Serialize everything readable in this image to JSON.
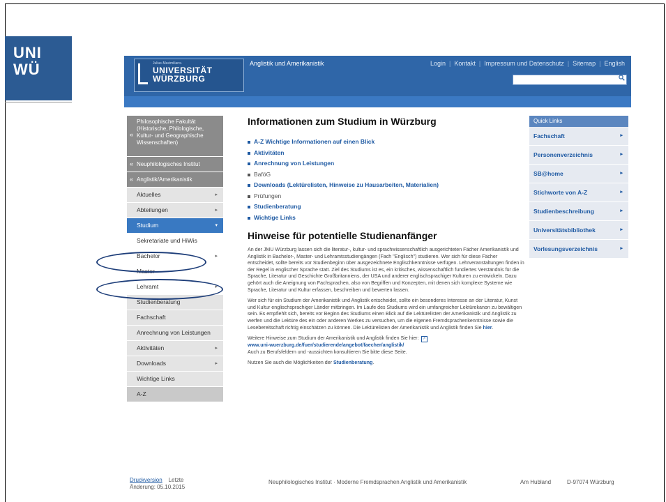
{
  "slide": {
    "logo_line1": "UNI",
    "logo_line2": "WÜ"
  },
  "header": {
    "logo_small": "Julius-Maximilians-",
    "logo_line1": "UNIVERSITÄT",
    "logo_line2": "WÜRZBURG",
    "institute": "Anglistik und Amerikanistik",
    "nav": [
      "Login",
      "Kontakt",
      "Impressum und Datenschutz",
      "Sitemap",
      "English"
    ],
    "search_placeholder": "",
    "search_icon": "search-icon"
  },
  "leftnav": {
    "faculty": "Philosophische Fakultät (Historische, Philologische, Kultur- und Geographische Wissenschaften)",
    "institute": "Neuphilologisches Institut",
    "department": "Anglistik/Amerikanistik",
    "items": [
      {
        "label": "Aktuelles",
        "arrow": "▸"
      },
      {
        "label": "Abteilungen",
        "arrow": "▸"
      },
      {
        "label": "Studium",
        "arrow": "▾"
      },
      {
        "label": "Sekretariate und HiWis",
        "arrow": ""
      },
      {
        "label": "Bachelor",
        "arrow": "▸"
      },
      {
        "label": "Master",
        "arrow": ""
      },
      {
        "label": "Lehramt",
        "arrow": "▸"
      },
      {
        "label": "Studienberatung",
        "arrow": ""
      },
      {
        "label": "Fachschaft",
        "arrow": ""
      },
      {
        "label": "Anrechnung von Leistungen",
        "arrow": ""
      },
      {
        "label": "Aktivitäten",
        "arrow": "▸"
      },
      {
        "label": "Downloads",
        "arrow": "▸"
      },
      {
        "label": "Wichtige Links",
        "arrow": ""
      },
      {
        "label": "A-Z",
        "arrow": ""
      }
    ]
  },
  "main": {
    "title": "Informationen zum Studium in Würzburg",
    "links": [
      "A-Z Wichtige Informationen auf einen Blick",
      "Aktivitäten",
      "Anrechnung von Leistungen",
      "BaföG",
      "Downloads (Lektürelisten, Hinweise zu Hausarbeiten, Materialien)",
      "Prüfungen",
      "Studienberatung",
      "Wichtige Links"
    ],
    "subtitle": "Hinweise für potentielle Studienanfänger",
    "para1": "An der JMU Würzburg lassen sich die literatur-, kultur- und sprachwissenschaftlich ausgerichteten Fächer Amerikanistik und Anglistik in Bachelor-, Master- und Lehramtsstudiengängen (Fach \"Englisch\") studieren. Wer sich für diese Fächer entscheidet, sollte bereits vor Studienbeginn über ausgezeichnete Englischkenntnisse verfügen. Lehrveranstaltungen finden in der Regel in englischer Sprache statt. Ziel des Studiums ist es, ein kritisches, wissenschaftlich fundiertes Verständnis für die Sprache, Literatur und Geschichte Großbritanniens, der USA und anderer englischsprachiger Kulturen zu entwickeln. Dazu gehört auch die Aneignung von Fachsprachen, also von Begriffen und Konzepten, mit denen sich komplexe Systeme wie Sprache, Literatur und Kultur erfassen, beschreiben und bewerten lassen.",
    "para2": "Wer sich für ein Studium der Amerikanistik und Anglistik entscheidet, sollte ein besonderes Interesse an der Literatur, Kunst und Kultur englischsprachiger Länder mitbringen. Im Laufe des Studiums wird ein umfangreicher Lektürekanon zu bewältigen sein. Es empfiehlt sich, bereits vor Beginn des Studiums einen Blick auf die Lektürelisten der Amerikanistik und Anglistik zu werfen und die Lektüre des ein oder anderen Werkes zu versuchen, um die eigenen Fremdsprachenkenntnisse sowie die Lesebereitschaft richtig einschätzen zu können. Die Lektürelisten der Amerikanistik und Anglistik finden Sie ",
    "para2_link": "hier",
    "para3_a": "Weitere Hinweise zum Studium der Amerikanistik und Anglistik finden Sie hier:",
    "para3_link": "www.uni-wuerzburg.de/fuer/studierende/angebot/faecher/anglistik/",
    "para3_b": "Auch zu Berufsfeldern und -aussichten konsultieren Sie bitte diese Seite.",
    "para4_a": "Nutzen Sie auch die Möglichkeiten der ",
    "para4_link": "Studienberatung",
    "para4_b": "."
  },
  "quick": {
    "heading": "Quick Links",
    "items": [
      "Fachschaft",
      "Personenverzeichnis",
      "SB@home",
      "Stichworte von A-Z",
      "Studienbeschreibung",
      "Universitätsbibliothek",
      "Vorlesungsverzeichnis"
    ]
  },
  "footer": {
    "print_link": "Druckversion",
    "changed_a": "Letzte",
    "changed_b": "Änderung: 05.10.2015",
    "institute": "Neuphilologisches Institut · Moderne Fremdsprachen Anglistik und Amerikanistik",
    "street": "Am Hubland",
    "city": "D-97074 Würzburg"
  }
}
